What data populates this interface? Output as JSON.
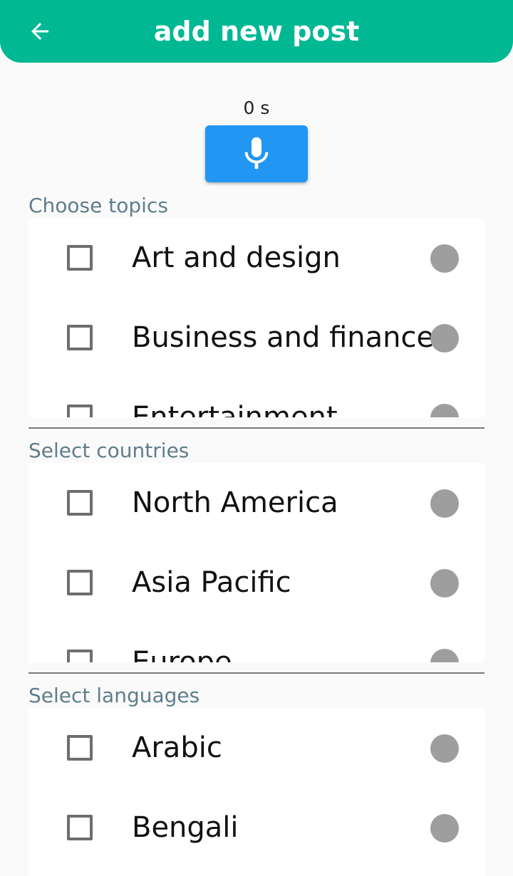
{
  "appbar": {
    "title": "add new post",
    "back_icon": "arrow-left-icon",
    "color": "#00b894"
  },
  "recorder": {
    "timer": "0 s",
    "mic_icon": "microphone-icon",
    "button_color": "#2196f3"
  },
  "topics": {
    "label": "Choose topics",
    "items": [
      {
        "label": "Art and design"
      },
      {
        "label": "Business and finance"
      },
      {
        "label": "Entertainment"
      }
    ]
  },
  "countries": {
    "label": "Select countries",
    "items": [
      {
        "label": "North America"
      },
      {
        "label": "Asia Pacific"
      },
      {
        "label": "Europe"
      }
    ]
  },
  "languages": {
    "label": "Select languages",
    "items": [
      {
        "label": "Arabic"
      },
      {
        "label": "Bengali"
      }
    ]
  }
}
